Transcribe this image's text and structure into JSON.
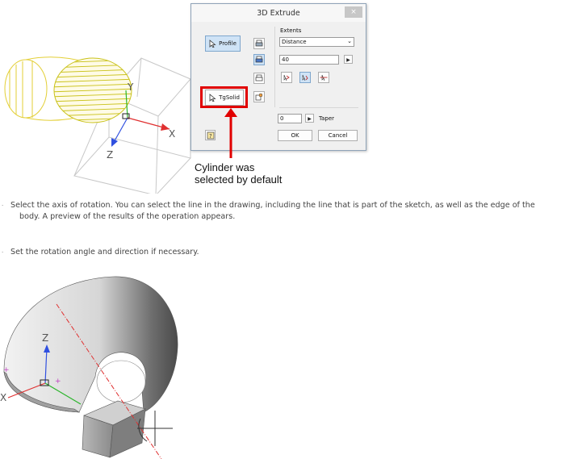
{
  "dialog": {
    "title": "3D Extrude",
    "close_glyph": "×",
    "profile_label": "Profile",
    "tgsolid_label": "TgSolid",
    "extents_label": "Extents",
    "extents_selected": "Distance",
    "distance_value": "40",
    "taper_value": "0",
    "taper_label": "Taper",
    "ok_label": "OK",
    "cancel_label": "Cancel"
  },
  "callout": {
    "line1": "Cylinder was",
    "line2": "selected by default"
  },
  "steps": [
    {
      "line1": "Select the axis of rotation. You can select the line in the drawing, including the line that is part of the sketch, as well as the edge of the",
      "line2": "body. A preview of the results of the operation appears."
    },
    {
      "line1": "Set the rotation angle and direction if necessary."
    }
  ],
  "axes_top": {
    "x": "X",
    "y": "Y",
    "z": "Z"
  },
  "axes_bottom": {
    "x": "X",
    "z": "Z"
  },
  "colors": {
    "wire_yellow": "#e3cf36",
    "hatch_yellow": "#c9c21a",
    "callout_red": "#e10000",
    "axis_red": "#e03030",
    "axis_green": "#2bb52b",
    "axis_blue": "#3050e0",
    "dialog_selected": "#cfe3f6"
  }
}
